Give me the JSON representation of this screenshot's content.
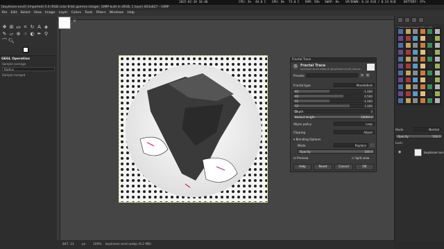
{
  "sysbar": {
    "date": "2025-02-20 16:40",
    "cpu": "CPU: 3%",
    "cpu_temp": "40.0 C",
    "gpu": "GPU: 0%",
    "gpu_temp": "73.0 C",
    "ram": "RAM: 50%",
    "swap": "SWAP: 0%",
    "net": "UP/DOWN: 0.14 KiB / 0.24 KiB",
    "battery": "BATTERY: 97%"
  },
  "window_title": "[boykisser-anvil] (imported)-5.0 (RGB color 8-bit gamma integer, GIMP built-in sRGB, 1 layer) 853x827 – GIMP",
  "menu": [
    "File",
    "Edit",
    "Select",
    "View",
    "Image",
    "Layer",
    "Colors",
    "Tools",
    "Filters",
    "Windows",
    "Help"
  ],
  "tool_options": {
    "title": "GEGL Operation",
    "sample_average": "Sample average",
    "mode_value": "Radius",
    "sample_merged": "Sample merged"
  },
  "status": {
    "coords": "847, 31",
    "unit": "px",
    "zoom": "100%",
    "file": "boykisser-anvil.webp (6.2 MB)"
  },
  "dialog": {
    "window_title": "Fractal Trace",
    "heading": "Fractal Trace",
    "subtitle": "boykisser-anvil.webp-6 ([boykisser-anvil] (impor...",
    "presets_label": "Presets:",
    "fractal_type_label": "Fractal type",
    "fractal_type_value": "Mandelbrot",
    "x1_label": "X1",
    "x1_value": "-1.000",
    "x2_label": "X2",
    "x2_value": "0.500",
    "y1_label": "Y1",
    "y1_value": "-1.000",
    "y2_label": "Y2",
    "y2_value": "1.000",
    "depth_label": "Depth",
    "depth_value": "3",
    "bailout_label": "Bailout length",
    "bailout_value": "10000.0",
    "abyss_label": "Abyss policy",
    "abyss_value": "Loop",
    "clipping_label": "Clipping",
    "clipping_value": "Adjust",
    "blending_label": "Blending Options",
    "mode_label": "Mode",
    "mode_value": "Replace",
    "opacity_label": "Opacity",
    "opacity_value": "100.0",
    "preview_label": "Preview",
    "split_label": "Split view",
    "btn_help": "Help",
    "btn_reset": "Reset",
    "btn_cancel": "Cancel",
    "btn_ok": "OK"
  },
  "right_dock": {
    "brush_header": "Clipboard Image (34 × 34)",
    "mode_label": "Mode",
    "mode_value": "Normal",
    "opacity_label": "Opacity",
    "opacity_value": "100.0",
    "lock_label": "Lock:",
    "layer_name": "boykisser-anvil"
  }
}
